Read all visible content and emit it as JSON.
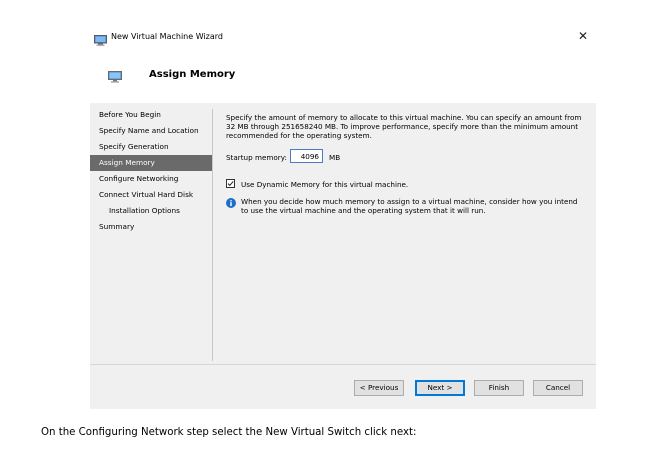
{
  "window": {
    "title": "New Virtual Machine Wizard",
    "close_glyph": "✕",
    "icon": "hyper-v-monitor-icon"
  },
  "header": {
    "title": "Assign Memory",
    "icon": "memory-monitor-icon"
  },
  "nav": {
    "items": [
      {
        "label": "Before You Begin",
        "active": false,
        "sub": false
      },
      {
        "label": "Specify Name and Location",
        "active": false,
        "sub": false
      },
      {
        "label": "Specify Generation",
        "active": false,
        "sub": false
      },
      {
        "label": "Assign Memory",
        "active": true,
        "sub": false
      },
      {
        "label": "Configure Networking",
        "active": false,
        "sub": false
      },
      {
        "label": "Connect Virtual Hard Disk",
        "active": false,
        "sub": false
      },
      {
        "label": "Installation Options",
        "active": false,
        "sub": true
      },
      {
        "label": "Summary",
        "active": false,
        "sub": false
      }
    ]
  },
  "main": {
    "description": "Specify the amount of memory to allocate to this virtual machine. You can specify an amount from 32 MB through 251658240 MB. To improve performance, specify more than the minimum amount recommended for the operating system.",
    "startup_memory_label": "Startup memory:",
    "startup_memory_value": "4096",
    "startup_memory_unit": "MB",
    "dynamic_memory_label": "Use Dynamic Memory for this virtual machine.",
    "dynamic_memory_checked": true,
    "info_text": "When you decide how much memory to assign to a virtual machine, consider how you intend to use the virtual machine and the operating system that it will run."
  },
  "buttons": {
    "previous": "< Previous",
    "next": "Next >",
    "finish": "Finish",
    "cancel": "Cancel"
  },
  "caption": "On the Configuring Network step select the New Virtual Switch click next:",
  "colors": {
    "content_bg": "#f0f0f0",
    "nav_active_bg": "#6a6a6a",
    "accent": "#0078d7",
    "info_icon": "#1e6fc9"
  }
}
